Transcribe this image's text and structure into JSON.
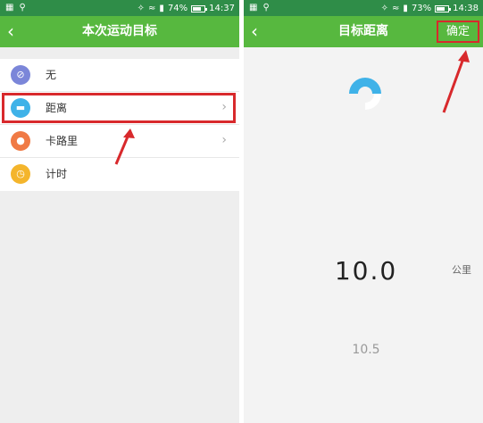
{
  "left_screen": {
    "status": {
      "battery": "74%",
      "time": "14:37",
      "battery_level": 0.74
    },
    "title": "本次运动目标",
    "items": [
      {
        "label": "无",
        "icon": "no-goal-icon",
        "color": "#7b86d9",
        "has_chevron": false
      },
      {
        "label": "距离",
        "icon": "distance-icon",
        "color": "#3fb2e8",
        "has_chevron": true
      },
      {
        "label": "卡路里",
        "icon": "calorie-icon",
        "color": "#f07a45",
        "has_chevron": true
      },
      {
        "label": "计时",
        "icon": "clock-icon",
        "color": "#f4b52c",
        "has_chevron": false
      }
    ]
  },
  "right_screen": {
    "status": {
      "battery": "73%",
      "time": "14:38",
      "battery_level": 0.73
    },
    "title": "目标距离",
    "confirm_label": "确定",
    "distance_value": "10.0",
    "distance_unit": "公里",
    "next_value": "10.5"
  },
  "colors": {
    "titlebar": "#57b83f",
    "statusbar": "#2f8d48",
    "highlight": "#d8292c"
  }
}
